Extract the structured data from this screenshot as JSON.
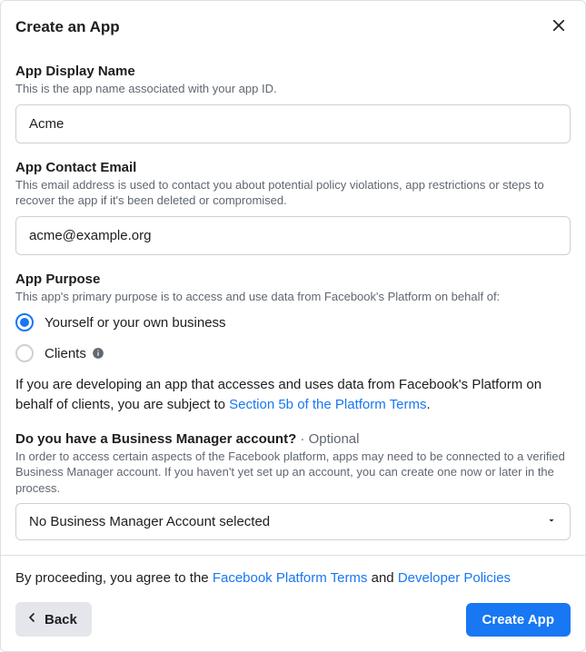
{
  "header": {
    "title": "Create an App"
  },
  "display_name": {
    "label": "App Display Name",
    "help": "This is the app name associated with your app ID.",
    "value": "Acme"
  },
  "contact_email": {
    "label": "App Contact Email",
    "help": "This email address is used to contact you about potential policy violations, app restrictions or steps to recover the app if it's been deleted or compromised.",
    "value": "acme@example.org"
  },
  "purpose": {
    "label": "App Purpose",
    "help": "This app's primary purpose is to access and use data from Facebook's Platform on behalf of:",
    "options": {
      "self": "Yourself or your own business",
      "clients": "Clients"
    },
    "note_pre": "If you are developing an app that accesses and uses data from Facebook's Platform on behalf of clients, you are subject to ",
    "note_link": "Section 5b of the Platform Terms",
    "note_post": "."
  },
  "bm": {
    "label": "Do you have a Business Manager account?",
    "optional_suffix": " · Optional",
    "help": "In order to access certain aspects of the Facebook platform, apps may need to be connected to a verified Business Manager account. If you haven't yet set up an account, you can create one now or later in the process.",
    "selected": "No Business Manager Account selected"
  },
  "footer": {
    "agree_pre": "By proceeding, you agree to the ",
    "terms_link": "Facebook Platform Terms",
    "agree_mid": " and ",
    "policies_link": "Developer Policies",
    "back_label": "Back",
    "create_label": "Create App"
  }
}
